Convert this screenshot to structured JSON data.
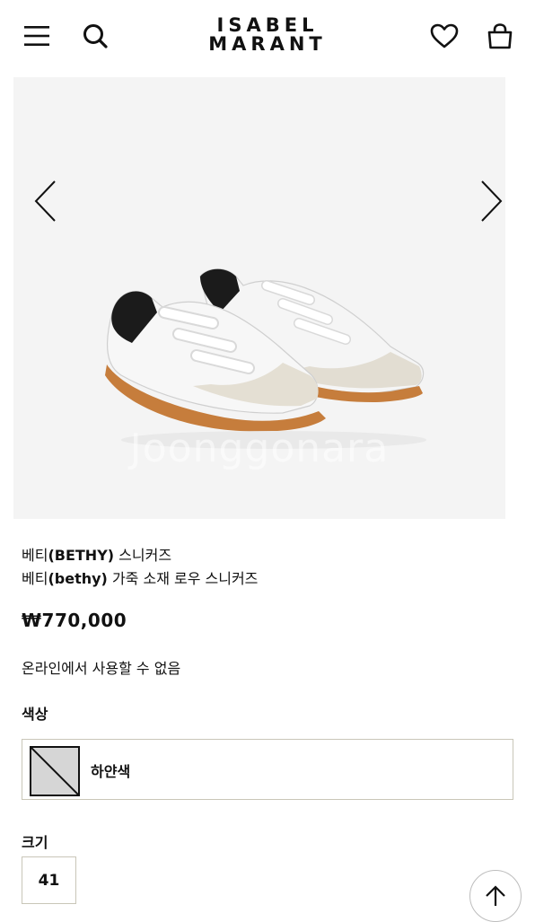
{
  "header": {
    "logo_line1": "ISABEL",
    "logo_line2": "MARANT",
    "icons": [
      "menu-icon",
      "search-icon",
      "heart-icon",
      "bag-icon"
    ]
  },
  "gallery": {
    "watermark": "Joonggonara",
    "prev_icon": "chevron-left-icon",
    "next_icon": "chevron-right-icon"
  },
  "product": {
    "name_ko_1": "베티",
    "name_en_1": "(BETHY)",
    "name_suffix_1": " 스니커즈",
    "name_ko_2": "베티",
    "name_en_2": "(bethy)",
    "name_suffix_2": " 가죽 소재 로우 스니커즈",
    "price": "₩770,000",
    "availability": "온라인에서 사용할 수 없음"
  },
  "color": {
    "label": "색상",
    "selected": "하얀색"
  },
  "size": {
    "label": "크기",
    "selected": "41"
  },
  "scroll_top_icon": "arrow-up-icon"
}
